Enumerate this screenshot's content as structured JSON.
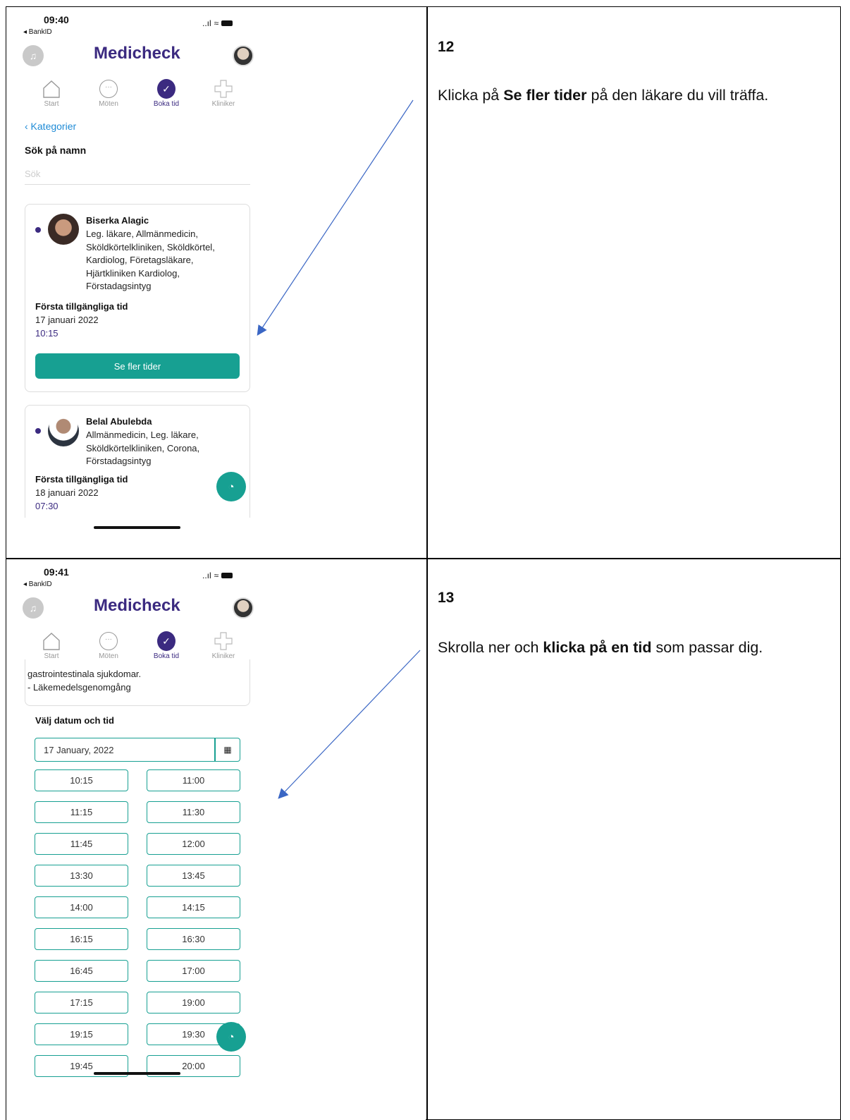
{
  "steps": [
    {
      "number": "12",
      "text_before": "Klicka på ",
      "text_bold": "Se fler tider",
      "text_after": " på den läkare du vill träffa.",
      "phone": {
        "time": "09:40",
        "back_app": "◂ BankID",
        "signal": "..ıl",
        "wifi": "≈",
        "brand": "Medicheck",
        "tabs": [
          {
            "label": "Start",
            "icon": "home-icon"
          },
          {
            "label": "Möten",
            "icon": "chat-icon"
          },
          {
            "label": "Boka tid",
            "icon": "check-icon"
          },
          {
            "label": "Kliniker",
            "icon": "plus-icon"
          }
        ],
        "back_link": "‹ Kategorier",
        "search_label": "Sök på namn",
        "search_placeholder": "Sök",
        "doctors": [
          {
            "name": "Biserka Alagic",
            "specialties": "Leg. läkare, Allmänmedicin, Sköldkörtelkliniken, Sköldkörtel, Kardiolog, Företagsläkare, Hjärtkliniken Kardiolog, Förstadagsintyg",
            "first_label": "Första tillgängliga tid",
            "first_date": "17 januari 2022",
            "first_time": "10:15",
            "button": "Se fler tider"
          },
          {
            "name": "Belal Abulebda",
            "specialties": "Allmänmedicin, Leg. läkare, Sköldkörtelkliniken, Corona, Förstadagsintyg",
            "first_label": "Första tillgängliga tid",
            "first_date": "18 januari 2022",
            "first_time": "07:30"
          }
        ]
      }
    },
    {
      "number": "13",
      "text_before": "Skrolla ner och ",
      "text_bold": "klicka på en tid",
      "text_after": " som passar dig.",
      "phone": {
        "time": "09:41",
        "back_app": "◂ BankID",
        "signal": "..ıl",
        "wifi": "≈",
        "brand": "Medicheck",
        "tabs": [
          {
            "label": "Start",
            "icon": "home-icon"
          },
          {
            "label": "Möten",
            "icon": "chat-icon"
          },
          {
            "label": "Boka tid",
            "icon": "check-icon"
          },
          {
            "label": "Kliniker",
            "icon": "plus-icon"
          }
        ],
        "desc_line1": "gastrointestinala sjukdomar.",
        "desc_line2": "- Läkemedelsgenomgång",
        "date_label": "Välj datum och tid",
        "date_value": "17 January, 2022",
        "slots_left": [
          "10:15",
          "11:15",
          "11:45",
          "13:30",
          "14:00",
          "16:15",
          "16:45",
          "17:15",
          "19:15",
          "19:45"
        ],
        "slots_right": [
          "11:00",
          "11:30",
          "12:00",
          "13:45",
          "14:15",
          "16:30",
          "17:00",
          "19:00",
          "19:30",
          "20:00"
        ]
      }
    }
  ],
  "colors": {
    "brand": "#3b2a80",
    "accent": "#17a092",
    "arrow": "#3a66c4",
    "link": "#1f8bd6"
  }
}
